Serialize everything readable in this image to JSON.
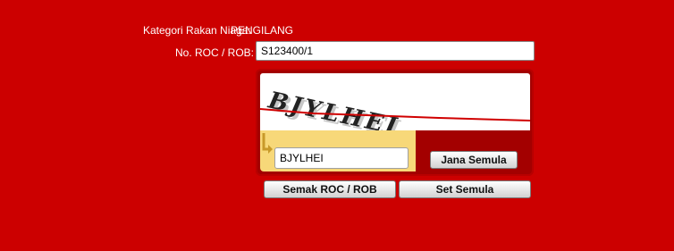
{
  "form": {
    "kategori_label": "Kategori Rakan Niaga:",
    "kategori_value": "PENGILANG",
    "roc_label": "No. ROC / ROB:",
    "roc_value": "S123400/1"
  },
  "captcha": {
    "image_text": "BJYLHEI",
    "input_value": "BJYLHEI",
    "refresh_label": "Jana Semula"
  },
  "buttons": {
    "check_label": "Semak ROC / ROB",
    "reset_label": "Set Semula"
  },
  "colors": {
    "background": "#cc0000",
    "captcha_panel": "#a30000",
    "captcha_input_area": "#f7d879"
  }
}
